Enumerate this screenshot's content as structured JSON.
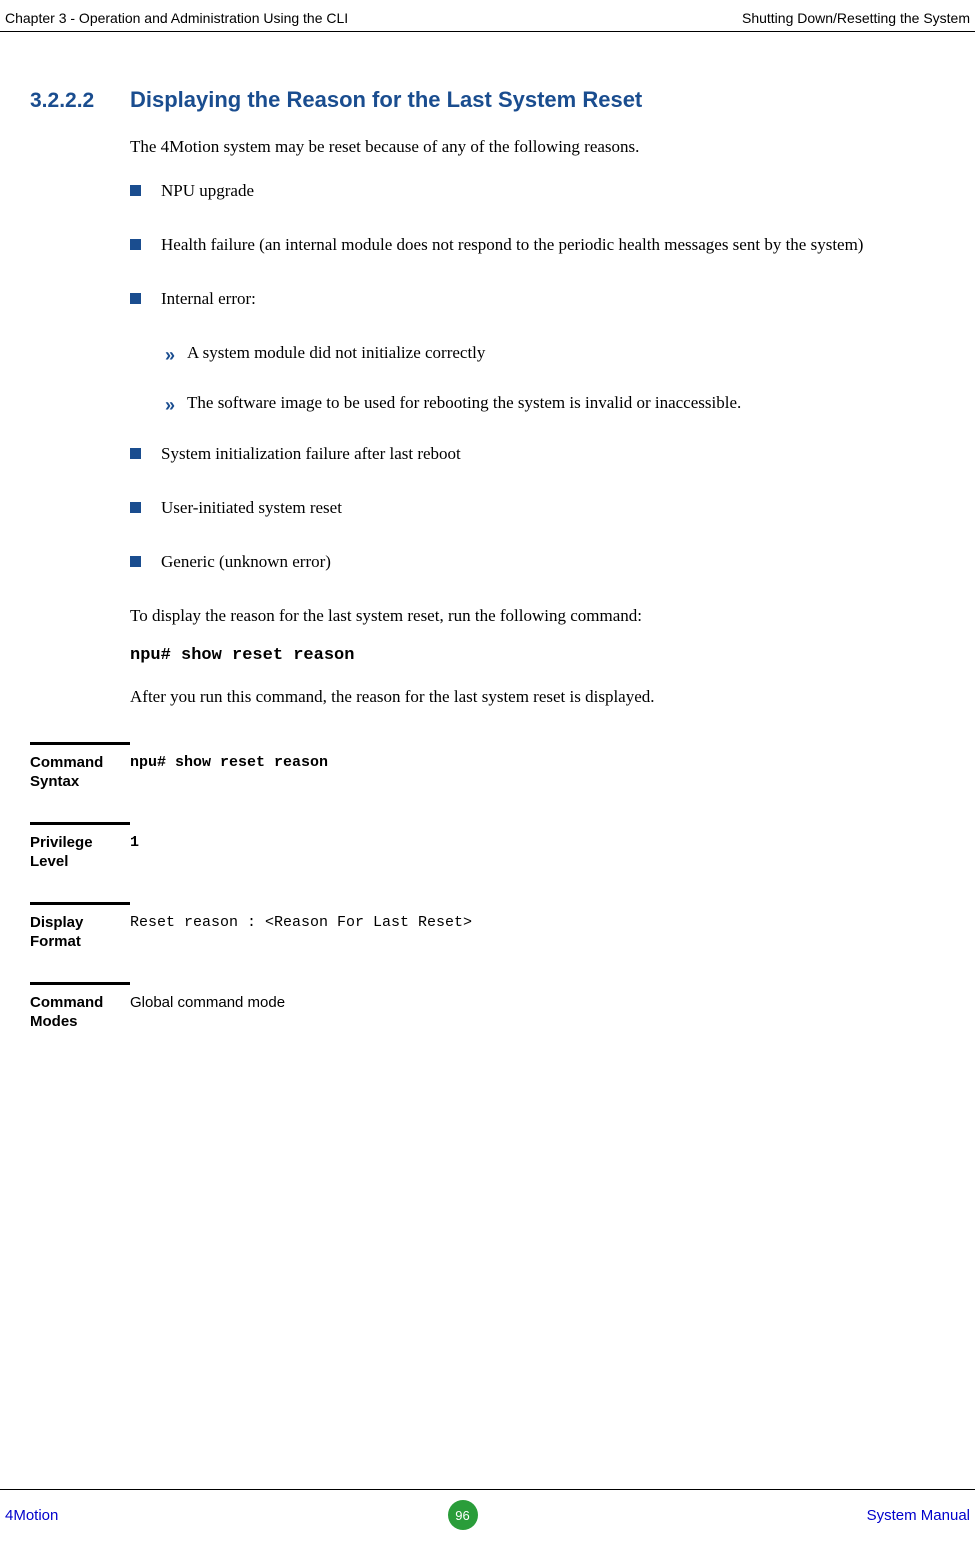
{
  "header": {
    "left": "Chapter 3 - Operation and Administration Using the CLI",
    "right": "Shutting Down/Resetting the System"
  },
  "section": {
    "number": "3.2.2.2",
    "title": "Displaying the Reason for the Last System Reset"
  },
  "intro": "The 4Motion system may be reset because of any of the following reasons.",
  "bullets": [
    "NPU upgrade",
    "Health failure (an internal module does not respond to the periodic health messages sent by the system)",
    "Internal error:"
  ],
  "sub_bullets": [
    "A system module did not initialize correctly",
    "The software image to be used for rebooting the system is invalid or inaccessible."
  ],
  "bullets2": [
    "System initialization failure after last reboot",
    "User-initiated system reset",
    "Generic (unknown error)"
  ],
  "para2": "To display the reason for the last system reset, run the following command:",
  "command": "npu# show reset reason",
  "para3": "After you run this command, the reason for the last system reset is displayed.",
  "info_blocks": {
    "syntax": {
      "label": "Command Syntax",
      "value": "npu# show reset reason"
    },
    "privilege": {
      "label": "Privilege Level",
      "value": "1"
    },
    "display": {
      "label": "Display Format",
      "value": "Reset reason : <Reason For Last Reset>"
    },
    "modes": {
      "label": "Command Modes",
      "value": "Global command mode"
    }
  },
  "footer": {
    "left": "4Motion",
    "center": "96",
    "right": "System Manual"
  }
}
